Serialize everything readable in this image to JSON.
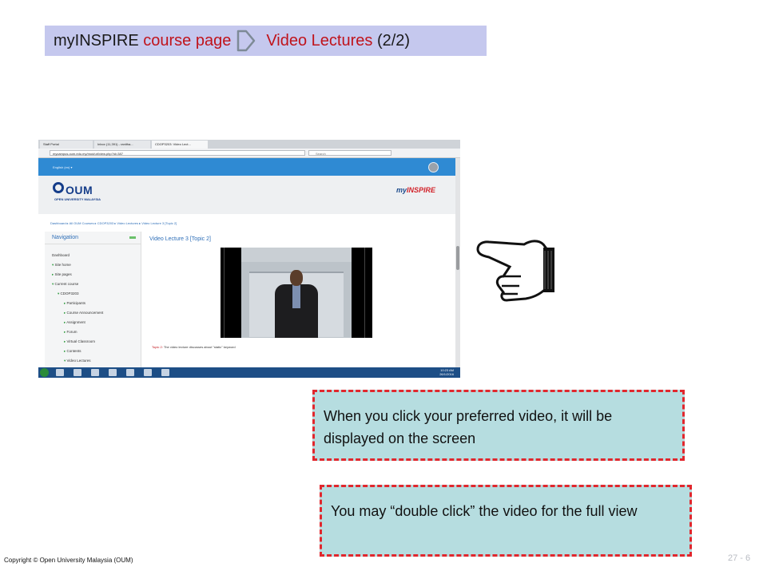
{
  "title": {
    "part1": "myINSPIRE",
    "part2": "course page",
    "part3": "Video Lectures",
    "part4": "(2/2)"
  },
  "screenshot": {
    "tabs": [
      "Staff Portal",
      "Inbox (11,391) - ranitha...",
      "CDOP3203: Video Lect..."
    ],
    "address": "mycampus.oum.edu.my/mod/url/view.php?id=387",
    "search": "Search",
    "lang": "English (en) ▾",
    "brand": "OUM",
    "brand_sub": "OPEN UNIVERSITY MALAYSIA",
    "myinspire_1": "my",
    "myinspire_2": "INSPIRE",
    "breadcrumb": "Dashboard ▸ All OUM Courses ▸ CDOP3203 ▸ Video Lectures ▸ Video Lecture 3 [Topic 2]",
    "nav_title": "Navigation",
    "nav_items": [
      "Dashboard",
      "Site home",
      "Site pages",
      "Current course",
      "CDOP3203",
      "Participants",
      "Course Announcement",
      "Assignment",
      "Forum",
      "Virtual Classroom",
      "Contents",
      "Video Lectures"
    ],
    "video_title": "Video Lecture 3 [Topic 2]",
    "caption_topic": "Topic 2:",
    "caption_text": " The video lecture discusses about \"static\" keyword",
    "time": "10:23 AM",
    "date": "26/1/2016"
  },
  "notes": {
    "note1": "When you click your preferred video, it will be displayed on the screen",
    "note2": "You may “double click” the video for the full view"
  },
  "footer": {
    "copyright": "Copyright © Open University Malaysia (OUM)",
    "page": "27 - 6"
  },
  "icons": [
    "chevron-arrow-icon",
    "pointing-hand-icon",
    "user-avatar-icon",
    "windows-start-icon"
  ],
  "colors": {
    "title_bg": "#c5c8ee",
    "accent_red": "#c0131b",
    "note_bg": "#b6dde0",
    "note_border": "#e1272d",
    "oum_blue": "#153d8a"
  }
}
